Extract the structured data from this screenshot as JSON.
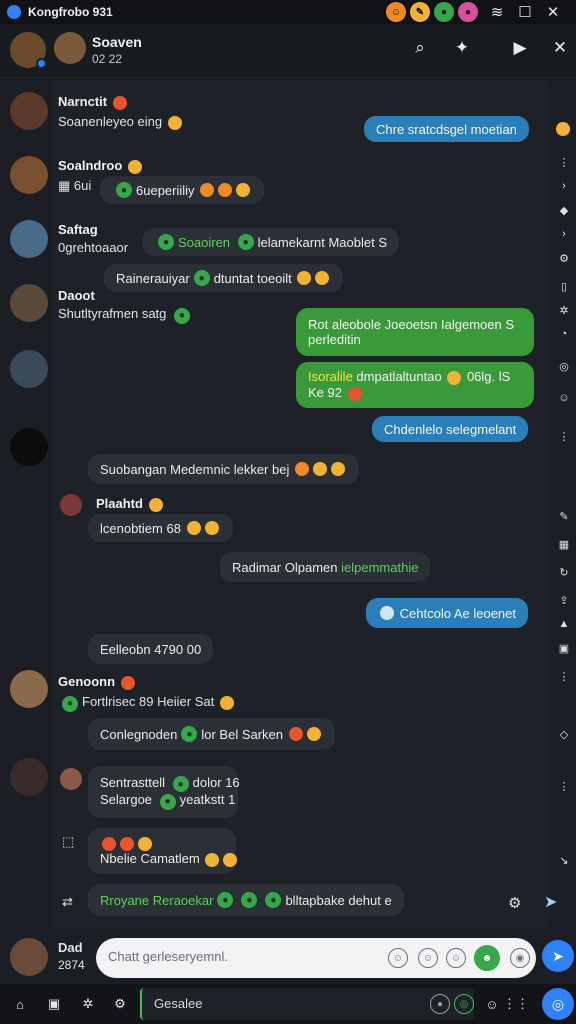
{
  "titlebar": {
    "title": "Kongfrobo 931",
    "controls": [
      "minimize",
      "restore",
      "close"
    ]
  },
  "header": {
    "name": "Soaven",
    "subtitle": "02 22"
  },
  "messages": [
    {
      "sender": "Narnctit",
      "text": "Soanenleyeo eing"
    },
    {
      "sender": "Soalndroo",
      "text": "6ui"
    },
    {
      "sender": "Saftag",
      "text": "0grehtoaaor"
    },
    {
      "sender": "Daoot",
      "text": "Shutltyrafmen satg"
    },
    {
      "sender": "Plaahtd",
      "text": "lcenobtiem 68"
    },
    {
      "sender": "Genoonn",
      "text": "Fortlrisec 89 Heiier Sat"
    }
  ],
  "bubbles": {
    "b1": "Chre sratcdsgel moetian",
    "b2": "6ueperiiliy",
    "b3a": "Soaoiren",
    "b3b": "lelamekarnt Maoblet S",
    "b4": "Rainerauiyar",
    "b4b": "dtuntat toeoilt",
    "b5": "Rot aleobole Joeoetsn",
    "b5b": "Ialgemoen S",
    "b5c": "perleditin",
    "b6a": "Isoralile",
    "b6b": "dmpatlaltuntao",
    "b6c": "06lg. lS",
    "b6d": "Ke 92",
    "b7": "Chdenlelo selegmelant",
    "b8": "Suobangan Medemnic lekker bej",
    "b9": "Radimar Olpamen",
    "b9b": "ielpemmathie",
    "b10": "Cehtcolo Ae leoenet",
    "b11": "Eelleobn 4790 00",
    "b12": "Conlegnoden",
    "b12b": "lor Bel Sarken",
    "b13a": "Sentrasttell",
    "b13b": "dolor 16",
    "b13c": "Selargoe",
    "b13d": "yeatkstt 1",
    "b14": "Nbelie Camatlem",
    "b15a": "Rroyane Reraoekar",
    "b15b": "blltapbake dehut e"
  },
  "composer": {
    "placeholder": "Chatt  gerleseryemnl.",
    "user_label": "Dad",
    "user_sub": "2874"
  },
  "bottombar": {
    "search": "Gesalee"
  },
  "colors": {
    "accent": "#2f81f7",
    "green": "#3a9a3a",
    "blue_bubble": "#2b7fb8"
  }
}
